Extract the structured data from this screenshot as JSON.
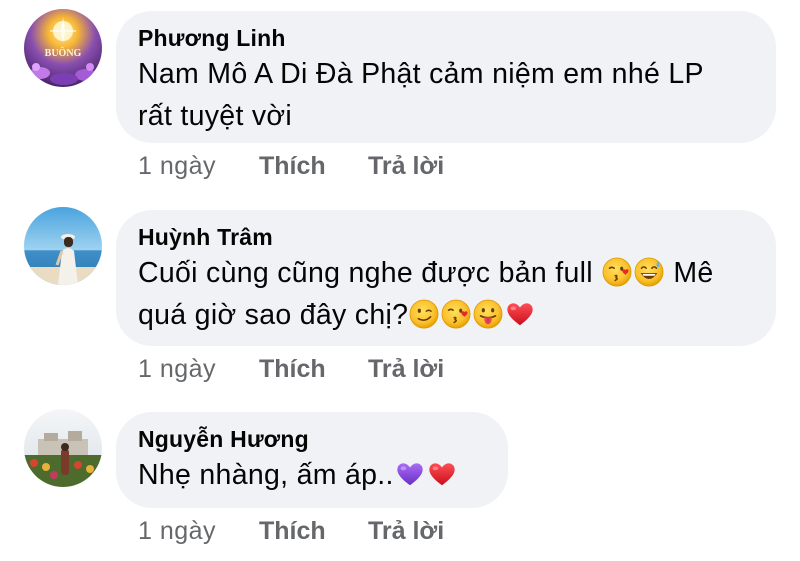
{
  "comments": [
    {
      "author": "Phương Linh",
      "text_lines": [
        "Nam Mô A Di Đà Phật cảm niệm em nhé LP",
        "rất tuyệt vời"
      ],
      "avatar_text": "BUÔNG",
      "time": "1 ngày",
      "like_label": "Thích",
      "reply_label": "Trả lời"
    },
    {
      "author": "Huỳnh Trâm",
      "line1_text": "Cuối cùng cũng nghe được bản full ",
      "line1_end": " Mê",
      "line2_text": "quá giờ sao đây chị?",
      "time": "1 ngày",
      "like_label": "Thích",
      "reply_label": "Trả lời",
      "emojis_line1": [
        "kiss-heart-emoji",
        "grinning-sweat-emoji"
      ],
      "emojis_line2": [
        "wink-emoji",
        "kiss-heart-emoji",
        "tongue-emoji",
        "red-heart-emoji"
      ]
    },
    {
      "author": "Nguyễn Hương",
      "text": "Nhẹ nhàng, ấm áp..",
      "time": "1 ngày",
      "like_label": "Thích",
      "reply_label": "Trả lời",
      "emojis": [
        "purple-heart-emoji",
        "red-heart-emoji"
      ]
    }
  ],
  "colors": {
    "bubble": "#f0f2f5",
    "text": "#050505",
    "meta": "#65676b",
    "heart_red": "#e8262f",
    "heart_purple": "#8e4be0",
    "emoji_yellow": "#ffcc33"
  }
}
